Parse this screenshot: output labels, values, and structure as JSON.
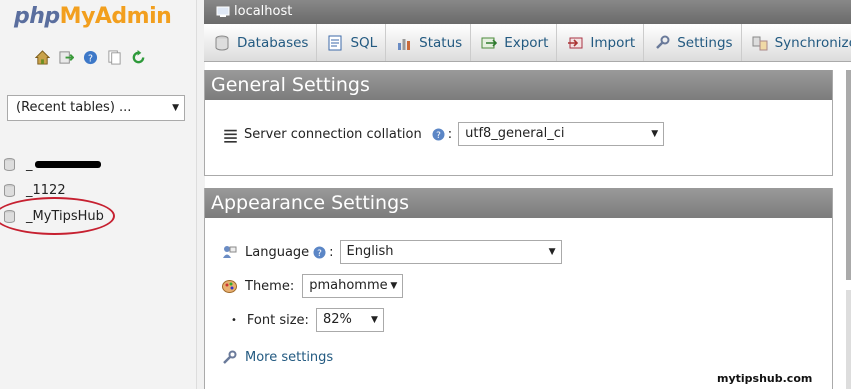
{
  "logo": {
    "part1": "php",
    "part2": "MyAdmin"
  },
  "nav_icons": [
    "home-icon",
    "exit-icon",
    "help-icon",
    "docs-icon",
    "reload-icon"
  ],
  "recent_tables": {
    "value": "(Recent tables) ..."
  },
  "databases": [
    {
      "name": "_",
      "redacted": true
    },
    {
      "name": "_1122"
    },
    {
      "name": "_MyTipsHub"
    }
  ],
  "server": {
    "label": "localhost"
  },
  "tabs": [
    {
      "label": "Databases",
      "icon": "database-icon"
    },
    {
      "label": "SQL",
      "icon": "sql-icon"
    },
    {
      "label": "Status",
      "icon": "status-icon"
    },
    {
      "label": "Export",
      "icon": "export-icon"
    },
    {
      "label": "Import",
      "icon": "import-icon"
    },
    {
      "label": "Settings",
      "icon": "settings-icon"
    },
    {
      "label": "Synchronize",
      "icon": "synchronize-icon"
    }
  ],
  "general_settings": {
    "title": "General Settings",
    "collation_label": "Server connection collation",
    "colon": ":",
    "collation_value": "utf8_general_ci"
  },
  "appearance_settings": {
    "title": "Appearance Settings",
    "language_label": "Language",
    "language_colon": ":",
    "language_value": "English",
    "theme_label": "Theme:",
    "theme_value": "pmahomme",
    "fontsize_label": "Font size:",
    "fontsize_value": "82%",
    "more_settings": "More settings"
  },
  "watermark": "mytipshub.com",
  "colors": {
    "link": "#235a81",
    "logo_blue": "#5a6e9e",
    "logo_orange": "#f29f1e",
    "highlight_circle": "#c62030"
  }
}
